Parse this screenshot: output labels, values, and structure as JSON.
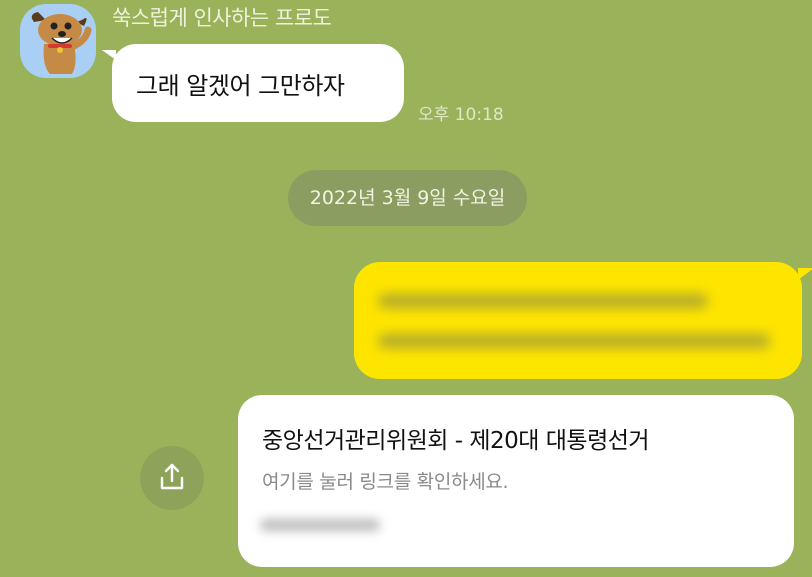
{
  "chat": {
    "incoming": {
      "sender": "쑥스럽게 인사하는 프로도",
      "avatar_icon": "frodo-dog-avatar-icon",
      "message": "그래 알겠어 그만하자",
      "time": "오후 10:18"
    },
    "date_divider": "2022년 3월 9일 수요일",
    "outgoing": {
      "message_state": "blurred",
      "color": "#fee500"
    },
    "link_preview": {
      "title": "중앙선거관리위원회 - 제20대 대통령선거",
      "description": "여기를 눌러 링크를 확인하세요.",
      "url_state": "blurred"
    },
    "share_button": {
      "icon": "share-upload-icon"
    }
  },
  "colors": {
    "background": "#9ab35a",
    "outgoing_bubble": "#fee500",
    "incoming_bubble": "#ffffff",
    "avatar_bg": "#a9d0f4"
  }
}
